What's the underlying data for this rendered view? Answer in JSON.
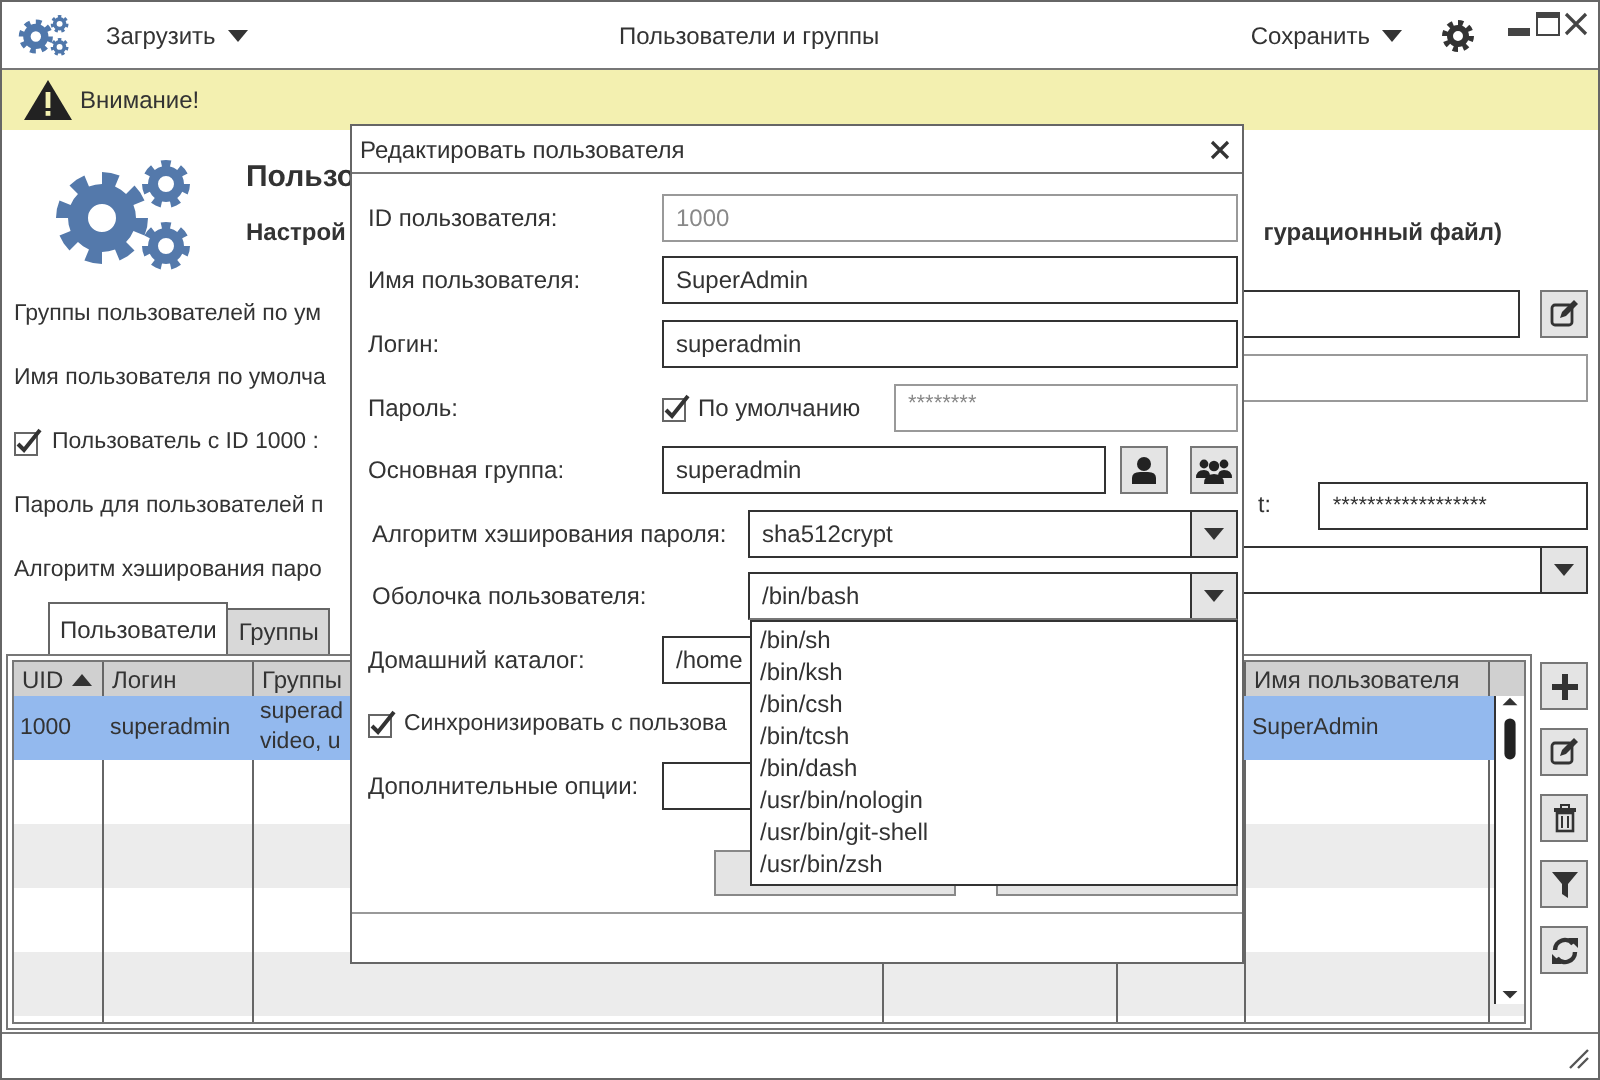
{
  "titlebar": {
    "load_menu": "Загрузить",
    "title": "Пользователи и группы",
    "save_menu": "Сохранить"
  },
  "warning": {
    "text": "Внимание!"
  },
  "header": {
    "title": "Пользо",
    "subtitle_left": "Настрой",
    "subtitle_right": "гурационный файл)"
  },
  "settings": [
    {
      "kind": "field-edit",
      "label": "Группы пользователей по ум"
    },
    {
      "kind": "field",
      "label": "Имя пользователя по умолча"
    },
    {
      "kind": "checkbox",
      "label": "Пользователь с ID 1000 :",
      "checked": true
    },
    {
      "kind": "password",
      "label": "Пароль для пользователей п",
      "label_right": "t:",
      "value": "******************"
    },
    {
      "kind": "select",
      "label": "Алгоритм хэширования паро"
    }
  ],
  "tabs": [
    {
      "label": "Пользователи",
      "selected": true
    },
    {
      "label": "Группы",
      "selected": false
    }
  ],
  "table": {
    "columns": [
      {
        "label": "UID",
        "sorted": true
      },
      {
        "label": "Логин",
        "sorted": false
      },
      {
        "label": "Группы",
        "sorted": false
      },
      {
        "label": "Имя пользователя",
        "sorted": false
      }
    ],
    "rows": [
      {
        "selected": true,
        "cells": [
          "1000",
          "superadmin",
          "superad\nvideo, u",
          "SuperAdmin"
        ]
      }
    ]
  },
  "dialog": {
    "title": "Редактировать пользователя",
    "fields": [
      {
        "kind": "text",
        "label": "ID пользователя:",
        "value": "1000",
        "disabled": true
      },
      {
        "kind": "text",
        "label": "Имя пользователя:",
        "value": "SuperAdmin",
        "disabled": false
      },
      {
        "kind": "text",
        "label": "Логин:",
        "value": "superadmin",
        "disabled": false
      },
      {
        "kind": "password",
        "label": "Пароль:",
        "checkbox_label": "По умолчанию",
        "checked": true,
        "value": "********"
      },
      {
        "kind": "group",
        "label": "Основная группа:",
        "value": "superadmin"
      },
      {
        "kind": "select",
        "label": "Алгоритм хэширования пароля:",
        "value": "sha512crypt"
      },
      {
        "kind": "select",
        "label": "Оболочка пользователя:",
        "value": "/bin/bash",
        "expanded": true,
        "options": [
          "/bin/sh",
          "/bin/ksh",
          "/bin/csh",
          "/bin/tcsh",
          "/bin/dash",
          "/usr/bin/nologin",
          "/usr/bin/git-shell",
          "/usr/bin/zsh"
        ]
      },
      {
        "kind": "text",
        "label": "Домашний каталог:",
        "value": "/home",
        "disabled": false
      },
      {
        "kind": "checkbox",
        "label": "Синхронизировать с пользова",
        "checked": true
      },
      {
        "kind": "text",
        "label": "Дополнительные опции:",
        "disabled": false
      }
    ]
  }
}
